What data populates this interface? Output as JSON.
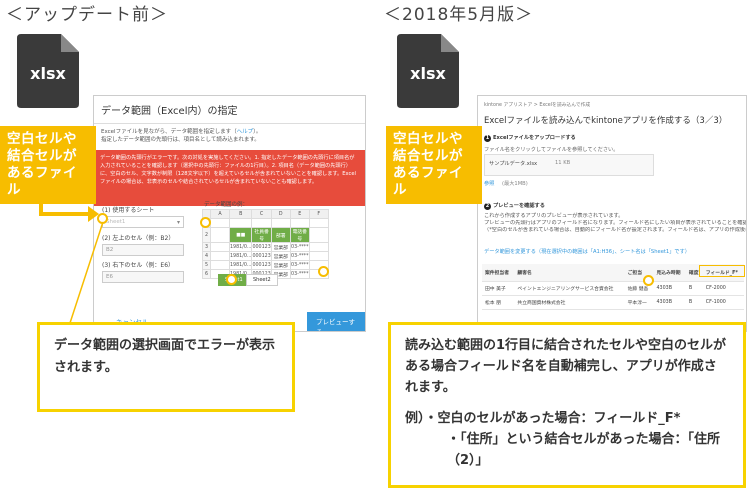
{
  "headings": {
    "before": "＜アップデート前＞",
    "after": "＜2018年5月版＞"
  },
  "file_icon": {
    "ext": "xlsx",
    "color": "#3a3a3a"
  },
  "tag": {
    "line1": "空白セルや",
    "line2": "結合セルが",
    "line3": "あるファイル"
  },
  "before": {
    "dialog_title": "データ範囲（Excel内）の指定",
    "desc1": "Excelファイルを見ながら、データ範囲を指定します（",
    "help_link": "ヘルプ",
    "desc1_end": "）。",
    "desc2": "指定したデータ範囲の先頭行は、項目名として読み込まれます。",
    "error": "データ範囲の先頭行がエラーです。次の対処を実施してください。1. 指定したデータ範囲の先頭行に項目名が入力されていることを確認します（選択中の先頭行：ファイルの1行目）。2. 項目名（データ範囲の先頭行）に、空白のセル、文字数が制限（128文字以下）を超えているセルが含まれていないことを確認します。Excelファイルの場合は、非表示のセルや結合されているセルが含まれていないことも確認します。",
    "sheet_label": "(1) 使用するシート",
    "sheet_value": "Sheet1",
    "start_label": "(2) 左上のセル（例：B2）",
    "start_value": "B2",
    "end_label": "(3) 右下のセル（例：E6）",
    "end_value": "E6",
    "example_label": "データ範囲の例：",
    "col_headers": [
      "",
      "A",
      "B",
      "C",
      "D",
      "E",
      "F"
    ],
    "rows": [
      [
        "1",
        "",
        "",
        "",
        "",
        "",
        ""
      ],
      [
        "2",
        "",
        "■■",
        "社員番号",
        "部署",
        "電話番号",
        ""
      ],
      [
        "3",
        "",
        "1981/0...",
        "000123",
        "営業部",
        "03-****",
        ""
      ],
      [
        "4",
        "",
        "1981/0...",
        "000123",
        "営業部",
        "03-****",
        ""
      ],
      [
        "5",
        "",
        "1981/0...",
        "000123",
        "営業部",
        "03-****",
        ""
      ],
      [
        "6",
        "",
        "1981/0...",
        "000123",
        "営業部",
        "03-****",
        ""
      ]
    ],
    "sheet_tabs": [
      "Sheet1",
      "Sheet2"
    ],
    "cancel": "キャンセル",
    "preview": "プレビューする",
    "note": "データ範囲の選択画面でエラーが表示されます。"
  },
  "after": {
    "crumb": "kintone アプリストア  >  Excelを読み込んで作成",
    "title": "Excelファイルを読み込んでkintoneアプリを作成する（3／3）",
    "step1": "Excelファイルをアップロードする",
    "step1_desc": "ファイル名をクリックしてファイルを参照してください。",
    "file_name": "サンプルデータ.xlsx",
    "file_size": "11 KB",
    "ref_link": "参照",
    "max_size": "(最大1MB)",
    "step2": "プレビューを確認する",
    "step2_desc1": "これから作成するアプリのプレビューが表示されています。",
    "step2_desc2": "プレビューの先頭行はアプリのフィールド名になります。フィールド名にしたい項目が表示されていることを確認してください。",
    "step2_desc3": "（*空白のセルが含まれている場合は、自動的にフィールド名が設定されます。フィールド名は、アプリの作成後に変更できます）",
    "change_range": "データ範囲を変更する（現在選択中の範囲は「A1:H36」、シート名は「Sheet1」です）",
    "table_headers": [
      "案件担当者",
      "顧客名",
      "ご担当",
      "見込み時期",
      "確度",
      "フィールド_F*"
    ],
    "table_rows": [
      [
        "田中 美子",
        "ペイントエンジニアリングサービス合資会社",
        "佐藤 健吾",
        "4303B",
        "B",
        "CF-2000"
      ],
      [
        "松本 朋",
        "共立商国資材株式会社",
        "平本淳一",
        "4303B",
        "B",
        "CF-1000"
      ]
    ],
    "note_main": "読み込む範囲の1行目に結合されたセルや空白のセルがある場合フィールド名を自動補完し、アプリが作成されます。",
    "ex_label": "例）・空白のセルがあった場合：フィールド_F*",
    "ex_line2": "・「住所」という結合セルがあった場合：「住所（2）」"
  },
  "colors": {
    "accent": "#f7bd00",
    "error": "#e74c3c",
    "link": "#3498db",
    "excel_green": "#70ad47"
  }
}
